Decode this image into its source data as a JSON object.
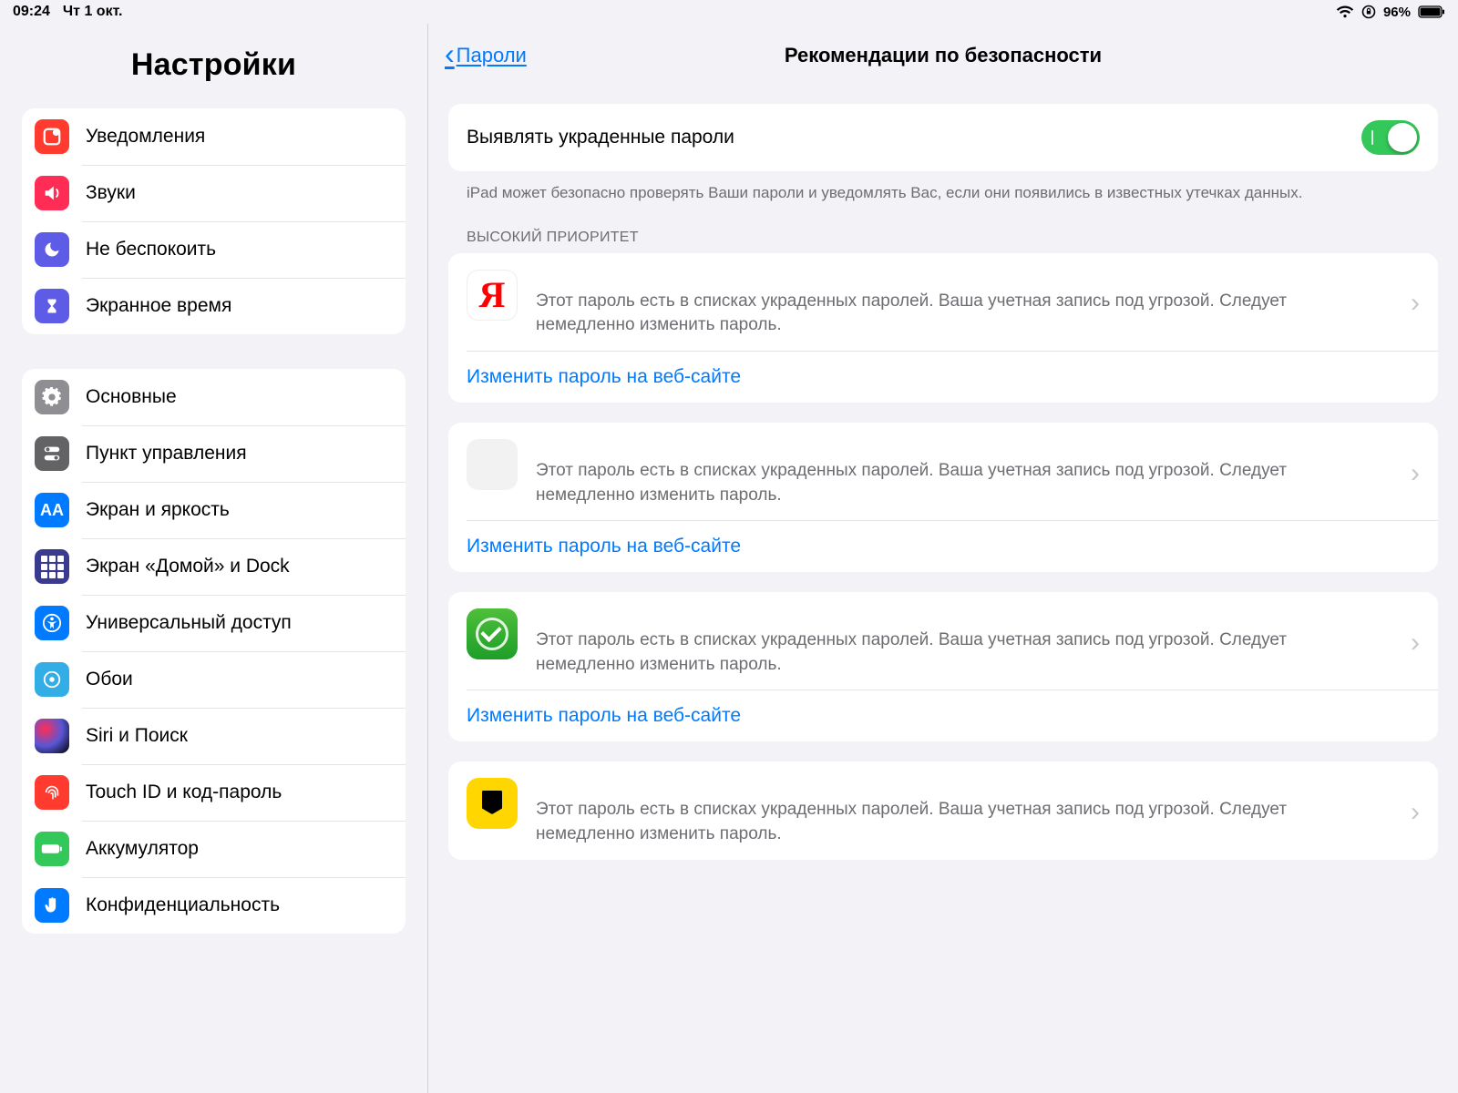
{
  "status": {
    "time": "09:24",
    "date": "Чт 1 окт.",
    "battery": "96%"
  },
  "sidebar": {
    "title": "Настройки",
    "group1": [
      "Уведомления",
      "Звуки",
      "Не беспокоить",
      "Экранное время"
    ],
    "group2": [
      "Основные",
      "Пункт управления",
      "Экран и яркость",
      "Экран «Домой» и Dock",
      "Универсальный доступ",
      "Обои",
      "Siri и Поиск",
      "Touch ID и код-пароль",
      "Аккумулятор",
      "Конфиденциальность"
    ]
  },
  "nav": {
    "back": "Пароли",
    "title": "Рекомендации по безопасности"
  },
  "toggle": {
    "label": "Выявлять украденные пароли"
  },
  "note": "iPad может безопасно проверять Ваши пароли и уведомлять Вас, если они появились в известных утечках данных.",
  "sectionHeader": "ВЫСОКИЙ ПРИОРИТЕТ",
  "alertMsg": "Этот пароль есть в списках украденных паролей. Ваша учетная запись под угрозой. Следует немедленно изменить пароль.",
  "changeLink": "Изменить пароль на веб-сайте"
}
